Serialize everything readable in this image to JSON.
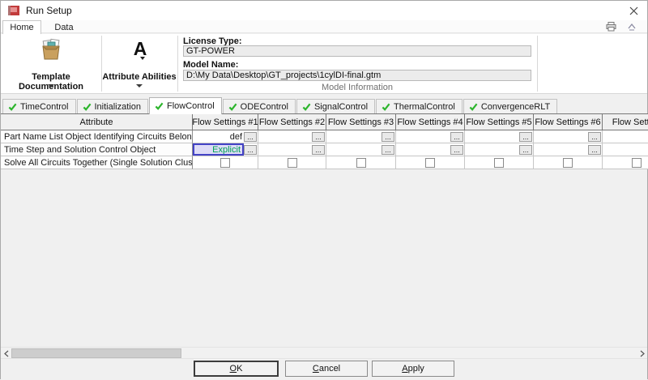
{
  "window": {
    "title": "Run Setup"
  },
  "ribbon": {
    "tabs": {
      "home": "Home",
      "data": "Data"
    },
    "groups": {
      "template_documentation": {
        "label": "Template Documentation"
      },
      "attribute_abilities": {
        "label": "Attribute Abilities",
        "icon_letter": "A"
      },
      "model_information": {
        "caption": "Model Information",
        "license_type_label": "License Type:",
        "license_type_value": "GT-POWER",
        "model_name_label": "Model Name:",
        "model_name_value": "D:\\My Data\\Desktop\\GT_projects\\1cylDI-final.gtm"
      }
    }
  },
  "control_tabs": [
    {
      "label": "TimeControl",
      "active": false
    },
    {
      "label": "Initialization",
      "active": false
    },
    {
      "label": "FlowControl",
      "active": true
    },
    {
      "label": "ODEControl",
      "active": false
    },
    {
      "label": "SignalControl",
      "active": false
    },
    {
      "label": "ThermalControl",
      "active": false
    },
    {
      "label": "ConvergenceRLT",
      "active": false
    }
  ],
  "table": {
    "attribute_header": "Attribute",
    "columns": [
      "Flow Settings #1",
      "Flow Settings #2",
      "Flow Settings #3",
      "Flow Settings #4",
      "Flow Settings #5",
      "Flow Settings #6",
      "Flow Setting"
    ],
    "ellipsis_label": "...",
    "rows": [
      {
        "attribute": "Part Name List Object Identifying Circuits Belonging to ...",
        "type": "object",
        "values": [
          "def",
          "",
          "",
          "",
          "",
          "",
          ""
        ],
        "value_styles": [
          "plain",
          "",
          "",
          "",
          "",
          "",
          ""
        ]
      },
      {
        "attribute": "Time Step and Solution Control Object",
        "type": "object",
        "values": [
          "Explicit",
          "",
          "",
          "",
          "",
          "",
          ""
        ],
        "value_styles": [
          "objlink",
          "",
          "",
          "",
          "",
          "",
          ""
        ],
        "selected_col": 0
      },
      {
        "attribute": "Solve All Circuits Together (Single Solution Cluster for ...",
        "type": "checkbox",
        "values": [
          false,
          false,
          false,
          false,
          false,
          false,
          false
        ]
      }
    ]
  },
  "footer": {
    "ok": {
      "mnemonic": "O",
      "rest": "K"
    },
    "cancel": {
      "mnemonic": "C",
      "rest": "ancel"
    },
    "apply": {
      "mnemonic": "A",
      "rest": "pply"
    }
  },
  "colors": {
    "check_green": "#2db52d",
    "object_link_green": "#00a254",
    "selected_cell_border": "#4343c6",
    "selected_cell_bg": "#dedcf7",
    "attribute_abilities_bar_blue": "#3f6fa8",
    "app_icon_red": "#c23b3b"
  }
}
